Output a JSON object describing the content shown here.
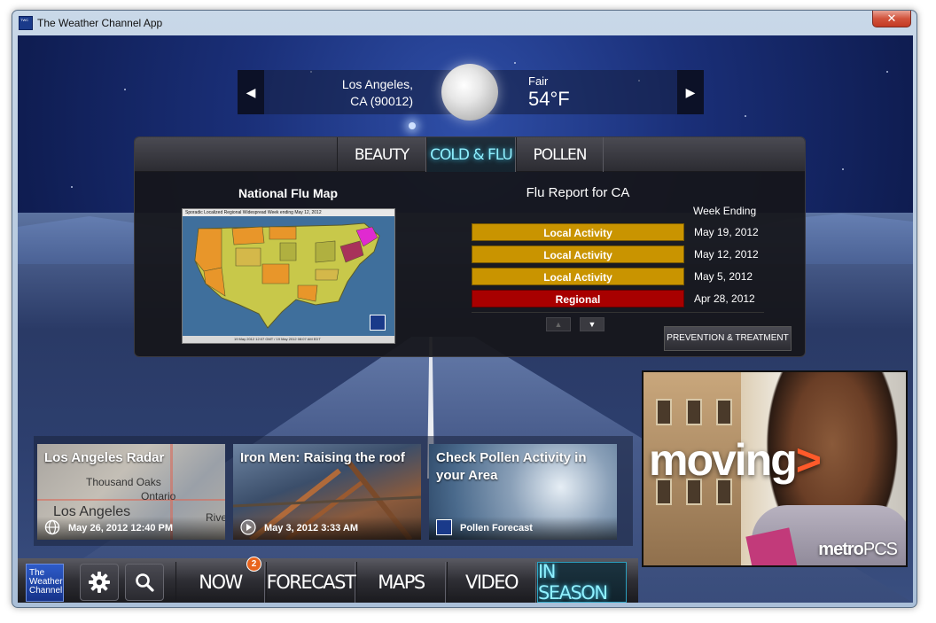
{
  "window": {
    "title": "The Weather Channel App",
    "close_glyph": "✕",
    "icon": "twc-icon"
  },
  "location": {
    "city": "Los Angeles,",
    "region": "CA (90012)",
    "condition": "Fair",
    "temperature": "54°F",
    "prev_glyph": "◀",
    "next_glyph": "▶",
    "weather_icon": "moon-icon"
  },
  "panel": {
    "tabs": [
      {
        "label": "BEAUTY"
      },
      {
        "label": "COLD & FLU"
      },
      {
        "label": "POLLEN"
      }
    ],
    "active_tab": "COLD & FLU",
    "map": {
      "title": "National Flu Map",
      "legend": "Sporadic   Localized   Regional   Widespread        Week ending May 12, 2012",
      "footer": "19 May 2012 12:07 GMT / 19 May 2012 08:07 AM EDT"
    },
    "report": {
      "title": "Flu Report for CA",
      "week_heading": "Week Ending",
      "rows": [
        {
          "level": "Local Activity",
          "date": "May 19, 2012",
          "color": "#c99400"
        },
        {
          "level": "Local Activity",
          "date": "May 12, 2012",
          "color": "#c99400"
        },
        {
          "level": "Local Activity",
          "date": "May 5, 2012",
          "color": "#c99400"
        },
        {
          "level": "Regional",
          "date": "Apr 28, 2012",
          "color": "#a80000"
        }
      ]
    },
    "pager_up": "▲",
    "pager_down": "▼",
    "prevention_label": "PREVENTION & TREATMENT"
  },
  "tiles": [
    {
      "title": "Los Angeles Radar",
      "meta": "May 26, 2012 12:40 PM",
      "icon": "globe-icon",
      "map_labels": [
        "Thousand Oaks",
        "Ontario",
        "Los Angeles",
        "Rive"
      ]
    },
    {
      "title": "Iron Men: Raising the roof",
      "meta": "May 3, 2012 3:33 AM",
      "icon": "play-icon"
    },
    {
      "title": "Check Pollen Activity in your Area",
      "meta": "Pollen Forecast",
      "icon": "twc-icon"
    }
  ],
  "ad": {
    "headline": "moving",
    "arrow": ">",
    "brand_bold": "metro",
    "brand_light": "PCS"
  },
  "nav": {
    "logo_text": "The Weather Channel",
    "settings_icon": "gear-icon",
    "search_icon": "search-icon",
    "tabs": [
      {
        "label": "NOW"
      },
      {
        "label": "FORECAST"
      },
      {
        "label": "MAPS"
      },
      {
        "label": "VIDEO"
      },
      {
        "label": "IN SEASON"
      }
    ],
    "active_tab": "IN SEASON",
    "badge_count": "2"
  },
  "colors": {
    "accent_cyan": "#8ff0ff",
    "local_activity": "#c99400",
    "regional": "#a80000",
    "badge": "#e8641e"
  }
}
